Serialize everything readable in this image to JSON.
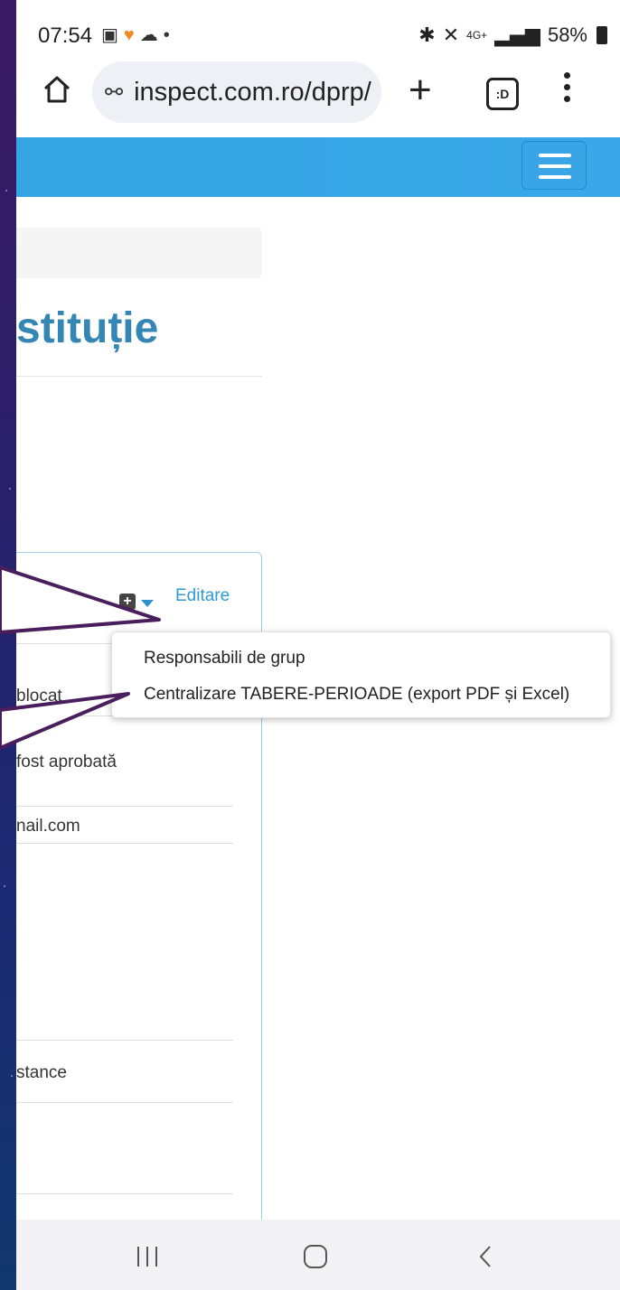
{
  "status_bar": {
    "time": "07:54",
    "right_text": "58%",
    "network": "4G+"
  },
  "browser": {
    "url": "inspect.com.ro/dprp/",
    "tabs_label": ":D"
  },
  "page": {
    "title": "stituție",
    "panel": {
      "edit_link": "Editare",
      "rows": [
        "blocat",
        "fost aprobată",
        "nail.com",
        "stance"
      ]
    }
  },
  "dropdown": {
    "items": [
      "Responsabili de grup",
      "Centralizare TABERE-PERIOADE (export PDF și Excel)"
    ]
  },
  "colors": {
    "header": "#35a5e3",
    "title": "#3487b5",
    "link": "#2e9ad6",
    "annotation": "#4a1d5c"
  }
}
